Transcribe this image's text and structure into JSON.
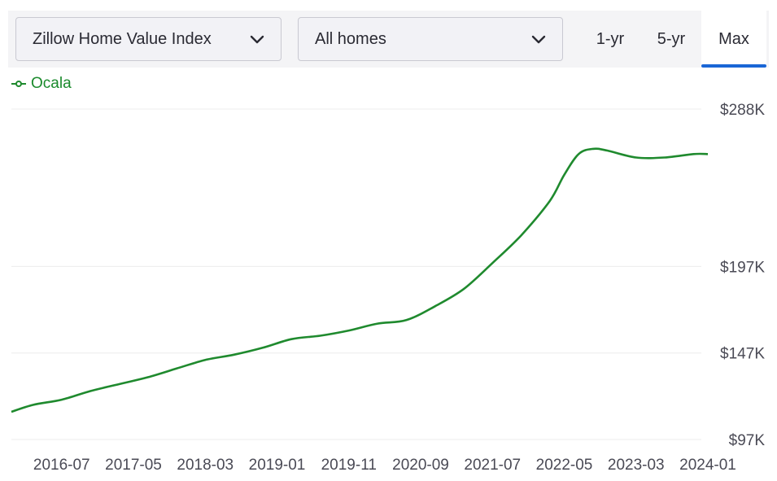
{
  "controls": {
    "metric_select": "Zillow Home Value Index",
    "homes_select": "All homes",
    "tabs": [
      {
        "label": "1-yr",
        "active": false
      },
      {
        "label": "5-yr",
        "active": false
      },
      {
        "label": "Max",
        "active": true
      }
    ]
  },
  "colors": {
    "series": "#1f8a2e",
    "grid": "#ececec",
    "active_tab": "#1a66d6"
  },
  "icons": {
    "select_chevron": "chevron-down-icon",
    "legend_marker": "line-marker-icon"
  },
  "chart_data": {
    "type": "line",
    "title": "",
    "xlabel": "",
    "ylabel": "",
    "x_tick_labels": [
      "2016-07",
      "2017-05",
      "2018-03",
      "2019-01",
      "2019-11",
      "2020-09",
      "2021-07",
      "2022-05",
      "2023-03",
      "2024-01"
    ],
    "y_tick_labels": [
      "$288K",
      "$197K",
      "$147K",
      "$97K"
    ],
    "y_tick_values": [
      288,
      197,
      147,
      97
    ],
    "ylim": [
      97,
      288
    ],
    "xlim": [
      "2015-12",
      "2024-01"
    ],
    "grid": true,
    "legend_position": "top-left",
    "series": [
      {
        "name": "Ocala",
        "x": [
          "2015-12",
          "2016-03",
          "2016-07",
          "2016-11",
          "2017-03",
          "2017-07",
          "2017-11",
          "2018-03",
          "2018-07",
          "2018-11",
          "2019-03",
          "2019-07",
          "2019-11",
          "2020-03",
          "2020-07",
          "2020-11",
          "2021-03",
          "2021-07",
          "2021-11",
          "2022-03",
          "2022-05",
          "2022-07",
          "2022-09",
          "2022-11",
          "2023-03",
          "2023-07",
          "2023-11",
          "2024-01"
        ],
        "values": [
          113,
          117,
          120,
          125,
          129,
          133,
          138,
          143,
          146,
          150,
          155,
          157,
          160,
          164,
          166,
          174,
          184,
          199,
          215,
          235,
          250,
          262,
          265,
          264,
          260,
          260,
          262,
          262
        ]
      }
    ]
  }
}
